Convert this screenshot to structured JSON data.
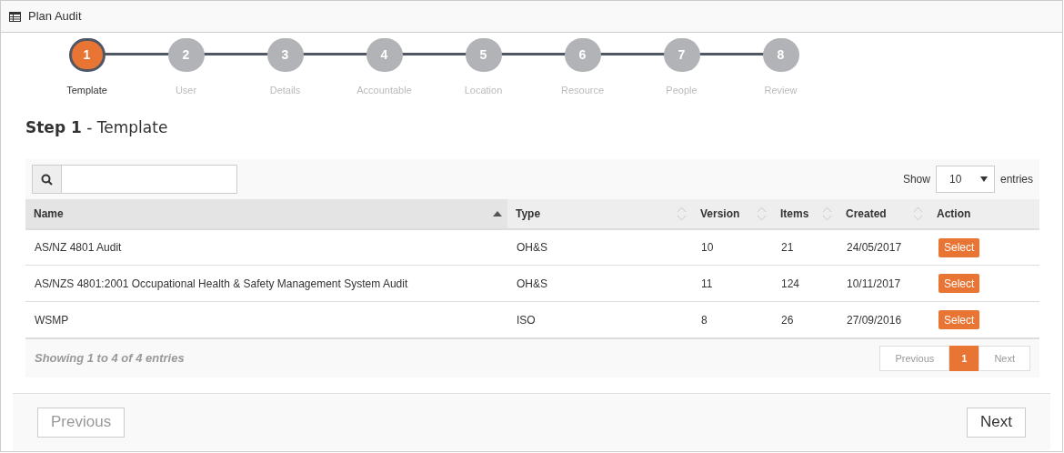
{
  "window": {
    "title": "Plan Audit"
  },
  "steps": [
    {
      "number": "1",
      "label": "Template",
      "selected": true
    },
    {
      "number": "2",
      "label": "User",
      "selected": false
    },
    {
      "number": "3",
      "label": "Details",
      "selected": false
    },
    {
      "number": "4",
      "label": "Accountable",
      "selected": false
    },
    {
      "number": "5",
      "label": "Location",
      "selected": false
    },
    {
      "number": "6",
      "label": "Resource",
      "selected": false
    },
    {
      "number": "7",
      "label": "People",
      "selected": false
    },
    {
      "number": "8",
      "label": "Review",
      "selected": false
    }
  ],
  "heading": {
    "step": "Step 1",
    "title": "- Template"
  },
  "length_menu": {
    "before": "Show",
    "value": "10",
    "after": "entries"
  },
  "table": {
    "columns": [
      {
        "label": "Name",
        "sortable": true,
        "sorted_ascending": true
      },
      {
        "label": "Type",
        "sortable": true,
        "sorted_ascending": false
      },
      {
        "label": "Version",
        "sortable": true,
        "sorted_ascending": false
      },
      {
        "label": "Items",
        "sortable": true,
        "sorted_ascending": false
      },
      {
        "label": "Created",
        "sortable": true,
        "sorted_ascending": false
      },
      {
        "label": "Action",
        "sortable": false
      }
    ],
    "rows": [
      {
        "cells": [
          "AS/NZ 4801 Audit",
          "OH&S",
          "10",
          "21",
          "24/05/2017"
        ],
        "action": "Select"
      },
      {
        "cells": [
          "AS/NZS 4801:2001 Occupational Health & Safety Management System Audit",
          "OH&S",
          "11",
          "124",
          "10/11/2017"
        ],
        "action": "Select"
      },
      {
        "cells": [
          "WSMP",
          "ISO",
          "8",
          "26",
          "27/09/2016"
        ],
        "action": "Select"
      }
    ],
    "info": "Showing 1 to 4 of 4 entries",
    "pagination": [
      {
        "label": "Previous",
        "kind": "nav",
        "disabled": true,
        "selected": false
      },
      {
        "label": "1",
        "kind": "page",
        "selected": true
      },
      {
        "label": "Next",
        "kind": "nav",
        "disabled": true,
        "selected": false
      }
    ]
  },
  "footer_buttons": [
    {
      "label": "Previous",
      "disabled": true
    },
    {
      "label": "Next",
      "disabled": false
    }
  ]
}
